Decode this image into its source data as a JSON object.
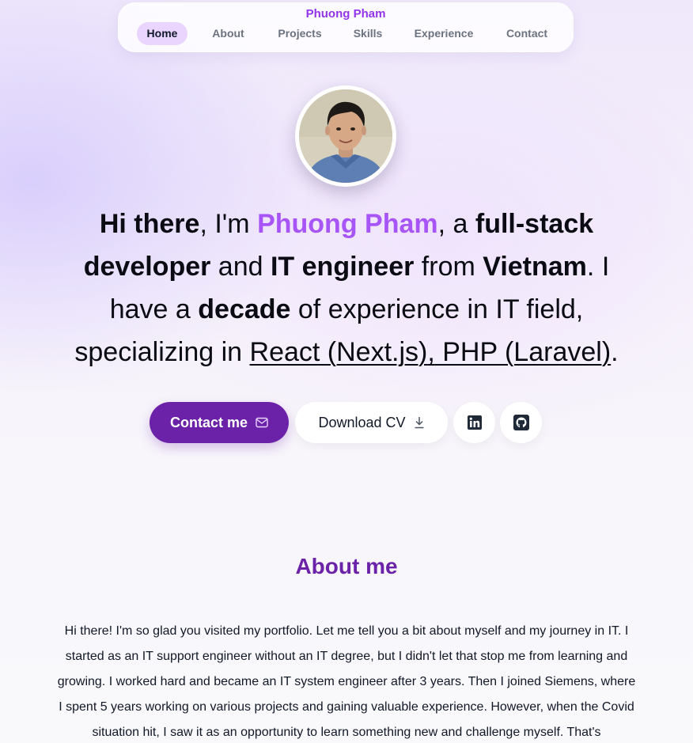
{
  "nav": {
    "brand": "Phuong Pham",
    "items": [
      {
        "label": "Home",
        "active": true
      },
      {
        "label": "About",
        "active": false
      },
      {
        "label": "Projects",
        "active": false
      },
      {
        "label": "Skills",
        "active": false
      },
      {
        "label": "Experience",
        "active": false
      },
      {
        "label": "Contact",
        "active": false
      }
    ]
  },
  "hero": {
    "intro": {
      "t1": "Hi there",
      "t2": ", I'm ",
      "name": "Phuong Pham",
      "t3": ", a ",
      "role1": "full-stack developer",
      "t4": " and ",
      "role2": "IT engineer",
      "t5": " from ",
      "country": "Vietnam",
      "t6": ". I have a ",
      "decade": "decade",
      "t7": " of experience in IT field, specializing in ",
      "skill1": "React (Next.js)",
      "t8": ",",
      "skill2": " PHP (Laravel)",
      "t9": "."
    },
    "contact_button": "Contact me",
    "download_button": "Download CV",
    "linkedin_label": "in",
    "avatar_icon": "person-photo"
  },
  "about": {
    "title": "About me",
    "body": "Hi there! I'm so glad you visited my portfolio. Let me tell you a bit about myself and my journey in IT. I started as an IT support engineer without an IT degree, but I didn't let that stop me from learning and growing. I worked hard and became an IT system engineer after 3 years. Then I joined Siemens, where I spent 5 years working on various projects and gaining valuable experience. However, when the Covid situation hit, I saw it as an opportunity to learn something new and challenge myself. That's"
  },
  "colors": {
    "accent": "#a855f7",
    "primary_button": "#6b21a8",
    "nav_active_bg": "#e9d5ff"
  }
}
